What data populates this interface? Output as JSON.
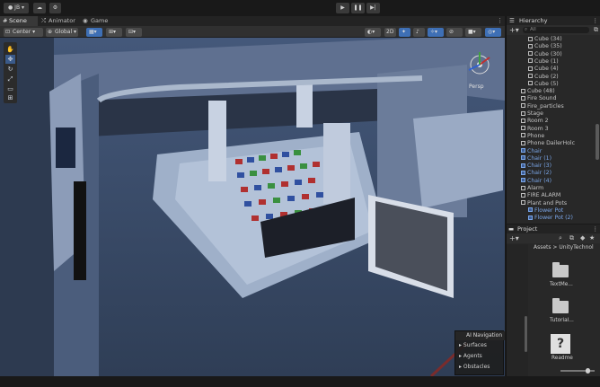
{
  "toolbar": {
    "account_label": "JB",
    "cloud_icon": "cloud-icon",
    "gear_icon": "gear-icon",
    "play_icon": "play-icon",
    "pause_icon": "pause-icon",
    "step_icon": "step-icon"
  },
  "tabs": [
    {
      "label": "Scene",
      "icon": "hash-icon"
    },
    {
      "label": "Animator",
      "icon": "animator-icon"
    },
    {
      "label": "Game",
      "icon": "gamepad-icon"
    }
  ],
  "scene_toolbar": {
    "pivot_mode": "Center",
    "space_mode": "Global",
    "projection_label": "Persp"
  },
  "ai_navigation": {
    "title": "AI Navigation",
    "items": [
      "Surfaces",
      "Agents",
      "Obstacles"
    ]
  },
  "hierarchy": {
    "title": "Hierarchy",
    "search_placeholder": "All",
    "items": [
      {
        "label": "Cube (34)",
        "indent": 4,
        "style": "normal"
      },
      {
        "label": "Cube (35)",
        "indent": 4,
        "style": "normal"
      },
      {
        "label": "Cube (30)",
        "indent": 4,
        "style": "normal"
      },
      {
        "label": "Cube (1)",
        "indent": 4,
        "style": "normal"
      },
      {
        "label": "Cube (4)",
        "indent": 4,
        "style": "normal"
      },
      {
        "label": "Cube (2)",
        "indent": 4,
        "style": "normal"
      },
      {
        "label": "Cube (5)",
        "indent": 4,
        "style": "normal"
      },
      {
        "label": "Cube (48)",
        "indent": 3,
        "style": "normal"
      },
      {
        "label": "Fire Sound",
        "indent": 3,
        "style": "normal"
      },
      {
        "label": "Fire_particles",
        "indent": 3,
        "style": "normal"
      },
      {
        "label": "Stage",
        "indent": 3,
        "style": "normal"
      },
      {
        "label": "Room 2",
        "indent": 3,
        "style": "normal"
      },
      {
        "label": "Room 3",
        "indent": 3,
        "style": "normal"
      },
      {
        "label": "Phone",
        "indent": 3,
        "style": "normal"
      },
      {
        "label": "Phone DailerHolc",
        "indent": 3,
        "style": "normal"
      },
      {
        "label": "Chair",
        "indent": 3,
        "style": "blue"
      },
      {
        "label": "Chair (1)",
        "indent": 3,
        "style": "blue"
      },
      {
        "label": "Chair (3)",
        "indent": 3,
        "style": "blue"
      },
      {
        "label": "Chair (2)",
        "indent": 3,
        "style": "blue"
      },
      {
        "label": "Chair (4)",
        "indent": 3,
        "style": "blue"
      },
      {
        "label": "Alarm",
        "indent": 3,
        "style": "normal"
      },
      {
        "label": "FIRE ALARM",
        "indent": 3,
        "style": "normal"
      },
      {
        "label": "Plant and Pots",
        "indent": 3,
        "style": "normal"
      },
      {
        "label": "Flower Pot",
        "indent": 4,
        "style": "blue"
      },
      {
        "label": "Flower Pot (2)",
        "indent": 4,
        "style": "blue"
      }
    ]
  },
  "project": {
    "title": "Project",
    "breadcrumb": "Assets > UnityTechnol",
    "assets": [
      {
        "label": "TextMe...",
        "type": "folder"
      },
      {
        "label": "Tutorial...",
        "type": "folder"
      },
      {
        "label": "Readme",
        "type": "unknown"
      }
    ]
  },
  "colors": {
    "accent_blue": "#3e6fb5",
    "prefab_blue": "#7aa6e8",
    "panel_bg": "#282828"
  }
}
